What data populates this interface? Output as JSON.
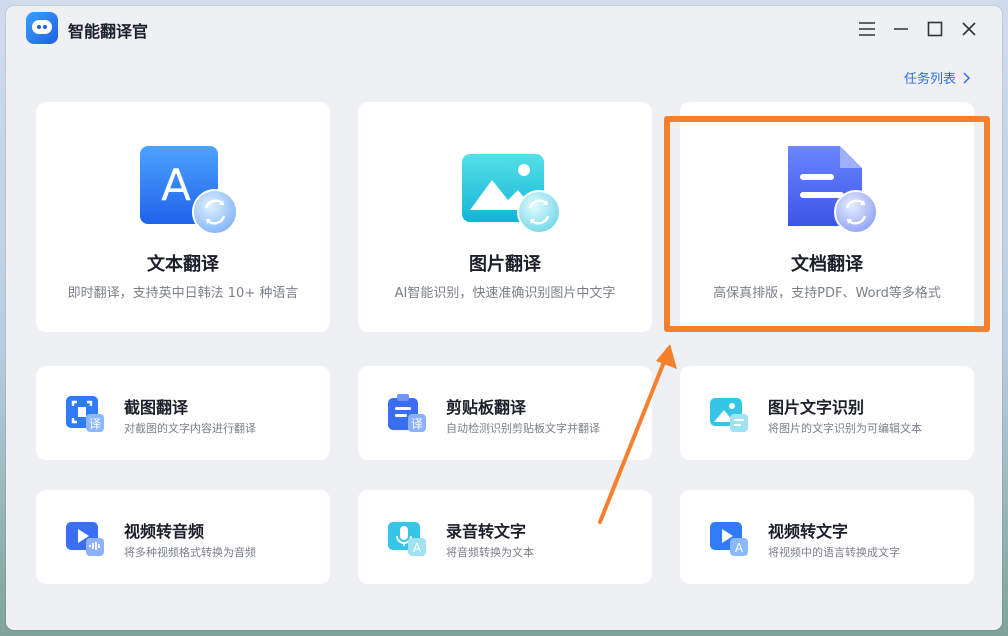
{
  "app": {
    "title": "智能翻译官"
  },
  "header": {
    "task_list": "任务列表"
  },
  "feature_cards": [
    {
      "title": "文本翻译",
      "desc": "即时翻译，支持英中日韩法 10+ 种语言",
      "icon": "text-translate-icon"
    },
    {
      "title": "图片翻译",
      "desc": "AI智能识别，快速准确识别图片中文字",
      "icon": "image-translate-icon"
    },
    {
      "title": "文档翻译",
      "desc": "高保真排版，支持PDF、Word等多格式",
      "icon": "document-translate-icon"
    }
  ],
  "tool_cards": [
    {
      "title": "截图翻译",
      "desc": "对截图的文字内容进行翻译",
      "icon": "screenshot-translate-icon"
    },
    {
      "title": "剪贴板翻译",
      "desc": "自动检测识别剪贴板文字并翻译",
      "icon": "clipboard-translate-icon"
    },
    {
      "title": "图片文字识别",
      "desc": "将图片的文字识别为可编辑文本",
      "icon": "image-ocr-icon"
    },
    {
      "title": "视频转音频",
      "desc": "将多种视频格式转换为音频",
      "icon": "video-to-audio-icon"
    },
    {
      "title": "录音转文字",
      "desc": "将音频转换为文本",
      "icon": "audio-to-text-icon"
    },
    {
      "title": "视频转文字",
      "desc": "将视频中的语言转换成文字",
      "icon": "video-to-text-icon"
    }
  ],
  "icon_glyphs": {
    "text_letter": "A",
    "translate_char": "译",
    "audio_letter": "A"
  },
  "colors": {
    "accent": "#2f6cf0",
    "highlight": "#f47f2d",
    "background": "#eef0f4"
  }
}
